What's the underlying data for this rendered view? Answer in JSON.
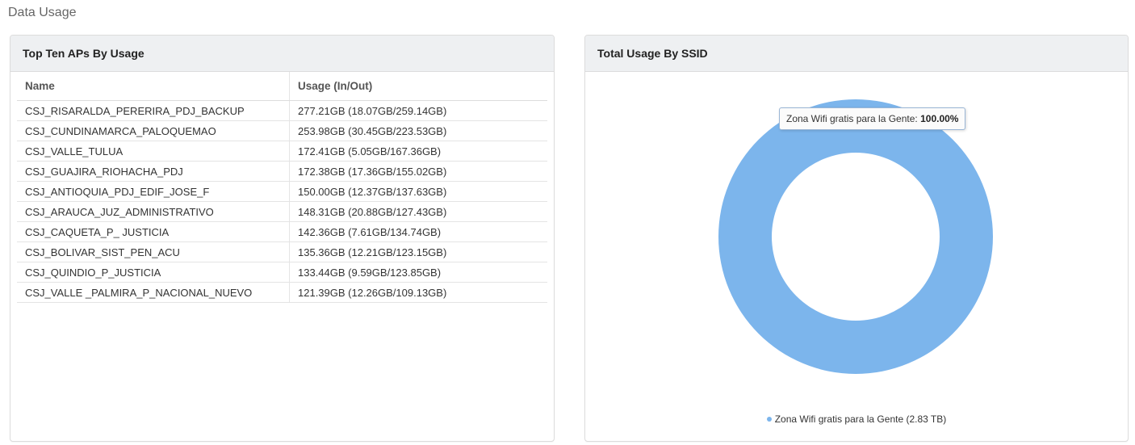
{
  "page": {
    "title": "Data Usage"
  },
  "top_aps": {
    "title": "Top Ten APs By Usage",
    "columns": [
      "Name",
      "Usage (In/Out)"
    ],
    "rows": [
      {
        "name": "CSJ_RISARALDA_PERERIRA_PDJ_BACKUP",
        "usage": "277.21GB (18.07GB/259.14GB)"
      },
      {
        "name": "CSJ_CUNDINAMARCA_PALOQUEMAO",
        "usage": "253.98GB (30.45GB/223.53GB)"
      },
      {
        "name": "CSJ_VALLE_TULUA",
        "usage": "172.41GB (5.05GB/167.36GB)"
      },
      {
        "name": "CSJ_GUAJIRA_RIOHACHA_PDJ",
        "usage": "172.38GB (17.36GB/155.02GB)"
      },
      {
        "name": "CSJ_ANTIOQUIA_PDJ_EDIF_JOSE_F",
        "usage": "150.00GB (12.37GB/137.63GB)"
      },
      {
        "name": "CSJ_ARAUCA_JUZ_ADMINISTRATIVO",
        "usage": "148.31GB (20.88GB/127.43GB)"
      },
      {
        "name": "CSJ_CAQUETA_P_ JUSTICIA",
        "usage": "142.36GB (7.61GB/134.74GB)"
      },
      {
        "name": "CSJ_BOLIVAR_SIST_PEN_ACU",
        "usage": "135.36GB (12.21GB/123.15GB)"
      },
      {
        "name": "CSJ_QUINDIO_P_JUSTICIA",
        "usage": "133.44GB (9.59GB/123.85GB)"
      },
      {
        "name": "CSJ_VALLE _PALMIRA_P_NACIONAL_NUEVO",
        "usage": "121.39GB (12.26GB/109.13GB)"
      }
    ]
  },
  "ssid_usage": {
    "title": "Total Usage By SSID",
    "tooltip_label": "Zona Wifi gratis para la Gente:",
    "tooltip_value": "100.00%",
    "legend_label": "Zona Wifi gratis para la Gente (2.83 TB)",
    "color": "#7cb5ec"
  },
  "chart_data": {
    "type": "pie",
    "categories": [
      "Zona Wifi gratis para la Gente"
    ],
    "values": [
      100.0
    ],
    "title": "Total Usage By SSID"
  }
}
